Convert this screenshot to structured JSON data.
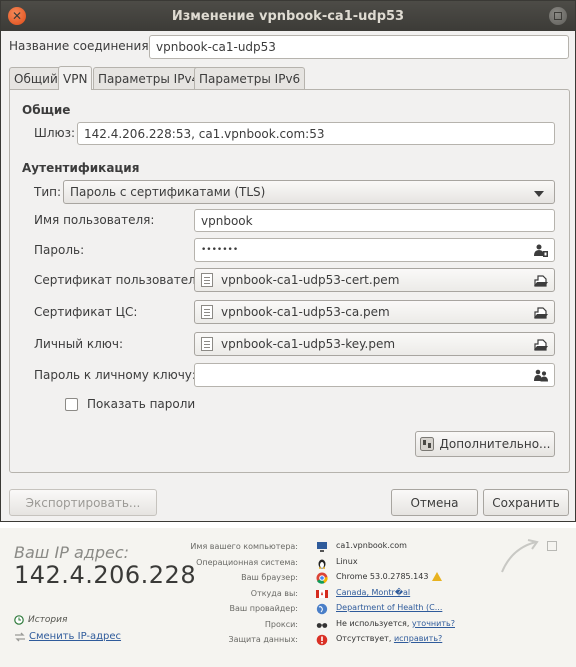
{
  "window": {
    "title": "Изменение vpnbook-ca1-udp53",
    "close_glyph": "✕"
  },
  "connection_name": {
    "label": "Название соединения:",
    "value": "vpnbook-ca1-udp53"
  },
  "tabs": [
    {
      "label": "Общий",
      "active": false
    },
    {
      "label": "VPN",
      "active": true
    },
    {
      "label": "Параметры IPv4",
      "active": false
    },
    {
      "label": "Параметры IPv6",
      "active": false
    }
  ],
  "general": {
    "heading": "Общие",
    "gateway_label": "Шлюз:",
    "gateway_value": "142.4.206.228:53, ca1.vpnbook.com:53"
  },
  "auth": {
    "heading": "Аутентификация",
    "type_label": "Тип:",
    "type_value": "Пароль с сертификатами (TLS)",
    "username_label": "Имя пользователя:",
    "username_value": "vpnbook",
    "password_label": "Пароль:",
    "password_value": "•••••••",
    "user_cert_label": "Сертификат пользователя:",
    "user_cert_value": "vpnbook-ca1-udp53-cert.pem",
    "ca_cert_label": "Сертификат ЦС:",
    "ca_cert_value": "vpnbook-ca1-udp53-ca.pem",
    "private_key_label": "Личный ключ:",
    "private_key_value": "vpnbook-ca1-udp53-key.pem",
    "key_password_label": "Пароль к личному ключу:",
    "key_password_value": "",
    "show_passwords_label": "Показать пароли",
    "show_passwords_checked": false
  },
  "advanced_button": "Дополнительно...",
  "footer": {
    "export_button": "Экспортировать...",
    "cancel_button": "Отмена",
    "save_button": "Сохранить"
  },
  "ip_widget": {
    "label": "Ваш IP адрес:",
    "ip": "142.4.206.228",
    "history_link": "История",
    "change_link": "Сменить IP-адрес",
    "rows": [
      {
        "key": "Имя вашего компьютера:",
        "value": "ca1.vpnbook.com",
        "icon": "computer-icon"
      },
      {
        "key": "Операционная система:",
        "value": "Linux",
        "icon": "linux-icon"
      },
      {
        "key": "Ваш браузер:",
        "value": "Chrome 53.0.2785.143",
        "icon": "chrome-icon"
      },
      {
        "key": "Откуда вы:",
        "value": "Canada, Montr�al",
        "icon": "canada-flag-icon"
      },
      {
        "key": "Ваш провайдер:",
        "value": "Department of Health (C...",
        "icon": "globe-icon"
      },
      {
        "key": "Прокси:",
        "value": "Не используется,",
        "link": "уточнить?",
        "icon": "glasses-icon"
      },
      {
        "key": "Защита данных:",
        "value": "Отсутствует,",
        "link": "исправить?",
        "icon": "alert-icon"
      }
    ]
  },
  "colors": {
    "titlebar": "#3c3b37",
    "close_button": "#df4a16",
    "link": "#2f5b9b",
    "warning": "#e8b21f"
  }
}
